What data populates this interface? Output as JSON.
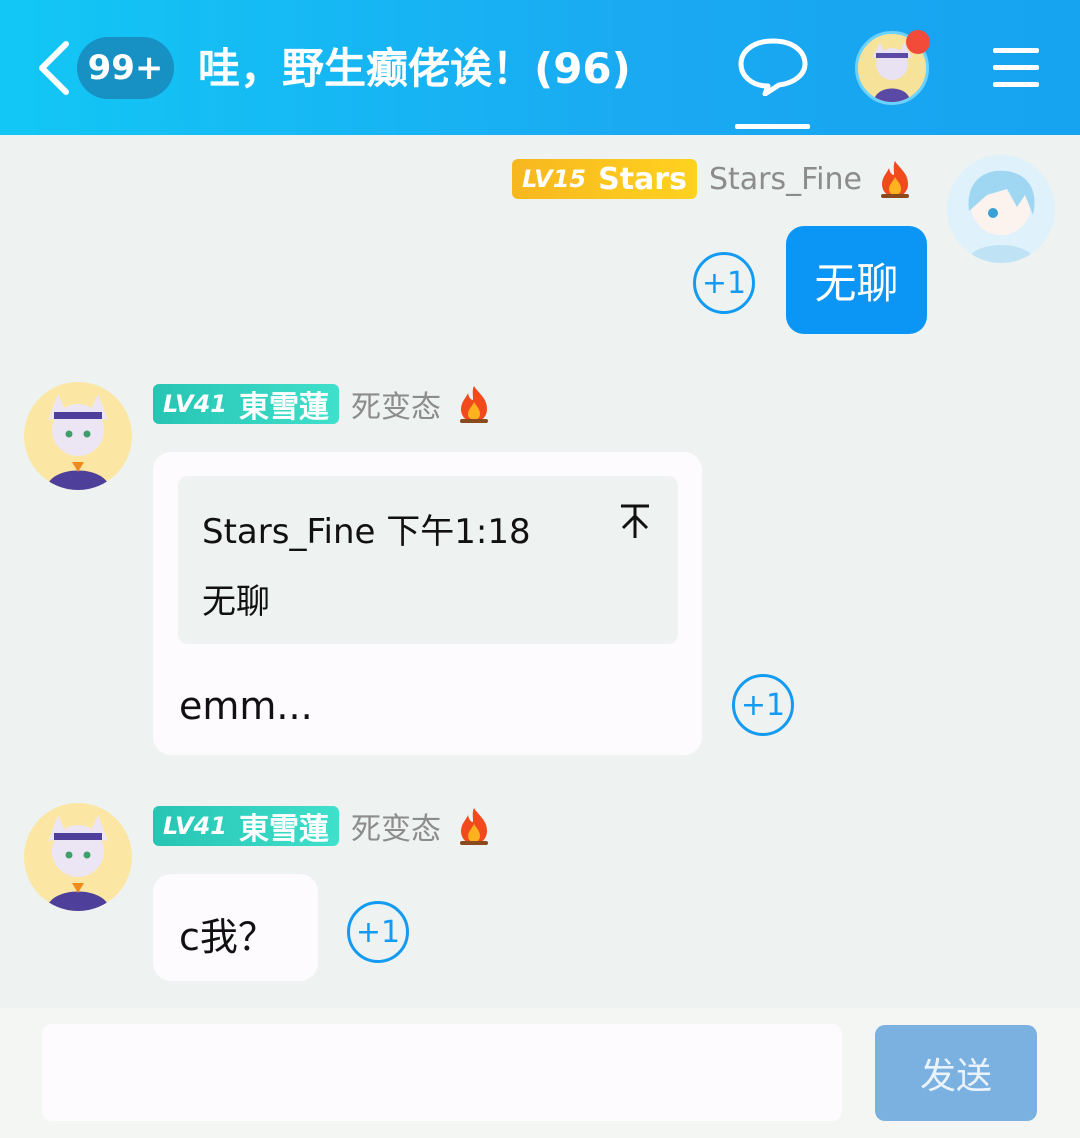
{
  "header": {
    "unread_count": "99+",
    "group_title": "哇，野生癫佬诶！(96)"
  },
  "messages": [
    {
      "sender_level": "LV15",
      "sender_title": "Stars",
      "sender_name": "Stars_Fine",
      "text": "无聊",
      "plus_one": "+1"
    },
    {
      "sender_level": "LV41",
      "sender_title": "東雪蓮",
      "sender_name": "死变态",
      "quote_meta": "Stars_Fine 下午1:18",
      "quote_text": "无聊",
      "text": "emm...",
      "plus_one": "+1"
    },
    {
      "sender_level": "LV41",
      "sender_title": "東雪蓮",
      "sender_name": "死变态",
      "text": "c我？",
      "plus_one": "+1"
    }
  ],
  "input": {
    "value": "",
    "send_label": "发送"
  },
  "colors": {
    "header_gradient_start": "#12c7f5",
    "self_bubble": "#0b95f5",
    "plus_one": "#139bf3",
    "level_gold": "#f7b71f",
    "level_teal": "#27c4b3",
    "send_disabled": "#7bb1e0",
    "notif_dot": "#f24b3a"
  },
  "icons": {
    "back": "chevron-left-icon",
    "chat": "chat-bubble-icon",
    "menu": "hamburger-menu-icon",
    "fire": "fire-icon",
    "jump_to_quote": "arrow-up-icon"
  }
}
